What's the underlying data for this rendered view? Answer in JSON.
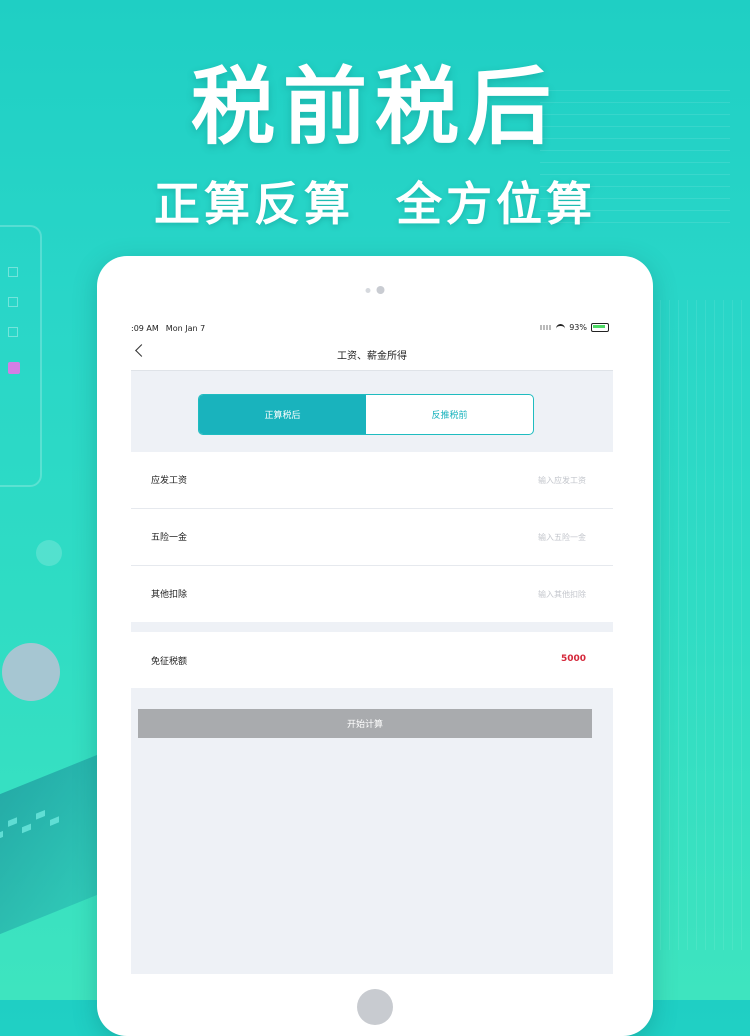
{
  "hero": {
    "title": "税前税后",
    "subtitle_left": "正算反算",
    "subtitle_right": "全方位算"
  },
  "status_bar": {
    "time": ":09 AM",
    "date": "Mon Jan 7",
    "battery": "93%"
  },
  "navbar": {
    "title": "工资、薪金所得"
  },
  "segment": {
    "options": [
      "正算税后",
      "反推税前"
    ],
    "selected": "正算税后"
  },
  "form": {
    "rows": [
      {
        "label": "应发工资",
        "placeholder": "输入应发工资"
      },
      {
        "label": "五险一金",
        "placeholder": "输入五险一金"
      },
      {
        "label": "其他扣除",
        "placeholder": "输入其他扣除"
      }
    ]
  },
  "exempt": {
    "label": "免征税额",
    "value": "5000"
  },
  "actions": {
    "calculate_label": "开始计算"
  },
  "colors": {
    "accent": "#19b3bd",
    "value_red": "#d5283b",
    "button_disabled": "#a9abae"
  }
}
